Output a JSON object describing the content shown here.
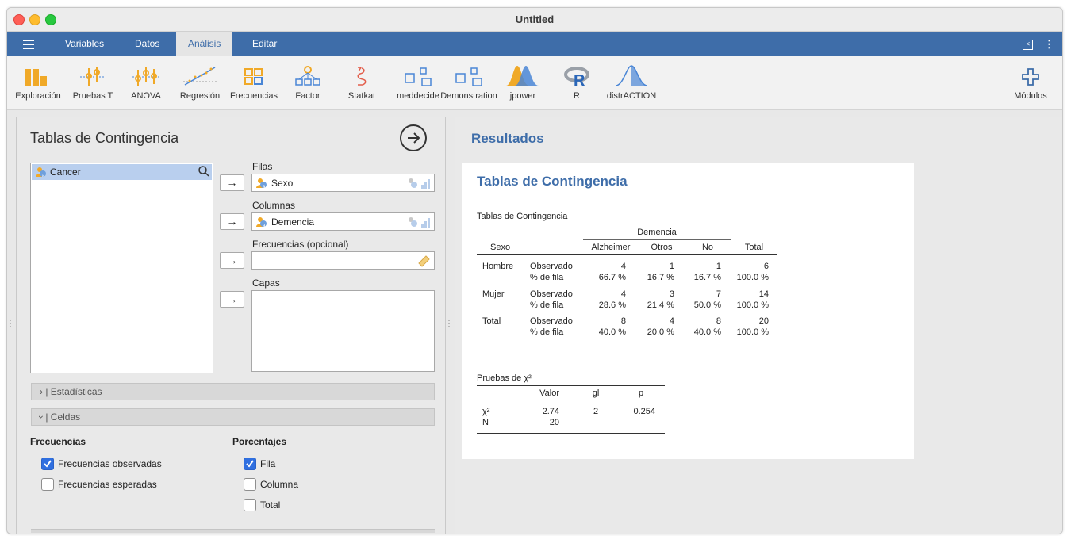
{
  "window": {
    "title": "Untitled"
  },
  "menu": {
    "tabs": [
      {
        "label": "Variables"
      },
      {
        "label": "Datos"
      },
      {
        "label": "Análisis"
      },
      {
        "label": "Editar"
      }
    ]
  },
  "toolbar": {
    "items": [
      {
        "label": "Exploración",
        "icon": "exploration-icon"
      },
      {
        "label": "Pruebas T",
        "icon": "t-tests-icon"
      },
      {
        "label": "ANOVA",
        "icon": "anova-icon"
      },
      {
        "label": "Regresión",
        "icon": "regression-icon"
      },
      {
        "label": "Frecuencias",
        "icon": "frequencies-icon"
      },
      {
        "label": "Factor",
        "icon": "factor-icon"
      },
      {
        "label": "Statkat",
        "icon": "statkat-icon"
      },
      {
        "label": "meddecide",
        "icon": "meddecide-icon"
      },
      {
        "label": "Demonstration",
        "icon": "demonstration-icon"
      },
      {
        "label": "jpower",
        "icon": "jpower-icon"
      },
      {
        "label": "R",
        "icon": "r-icon"
      },
      {
        "label": "distrACTION",
        "icon": "distraction-icon"
      }
    ],
    "modules_label": "Módulos",
    "accent": "#3e6da9"
  },
  "analysis": {
    "title": "Tablas de Contingencia",
    "source_vars": [
      "Cancer"
    ],
    "rows_label": "Filas",
    "rows_value": "Sexo",
    "cols_label": "Columnas",
    "cols_value": "Demencia",
    "freq_label": "Frecuencias (opcional)",
    "layers_label": "Capas",
    "section_stats": "Estadísticas",
    "section_cells": "Celdas",
    "counts_header": "Frecuencias",
    "observed_label": "Frecuencias observadas",
    "observed_checked": true,
    "expected_label": "Frecuencias esperadas",
    "expected_checked": false,
    "percent_header": "Porcentajes",
    "row_label": "Fila",
    "row_checked": true,
    "column_label": "Columna",
    "column_checked": false,
    "total_label": "Total",
    "total_checked": false
  },
  "results": {
    "header": "Resultados",
    "card_title": "Tablas de Contingencia",
    "table1": {
      "caption": "Tablas de Contingencia",
      "group_header": "Demencia",
      "row_var": "Sexo",
      "col_headers": [
        "Alzheimer",
        "Otros",
        "No",
        "Total"
      ],
      "rows": [
        {
          "group": "Hombre",
          "obs_label": "Observado",
          "pct_label": "% de fila",
          "obs": [
            "4",
            "1",
            "1",
            "6"
          ],
          "pct": [
            "66.7 %",
            "16.7 %",
            "16.7 %",
            "100.0 %"
          ]
        },
        {
          "group": "Mujer",
          "obs_label": "Observado",
          "pct_label": "% de fila",
          "obs": [
            "4",
            "3",
            "7",
            "14"
          ],
          "pct": [
            "28.6 %",
            "21.4 %",
            "50.0 %",
            "100.0 %"
          ]
        },
        {
          "group": "Total",
          "obs_label": "Observado",
          "pct_label": "% de fila",
          "obs": [
            "8",
            "4",
            "8",
            "20"
          ],
          "pct": [
            "40.0 %",
            "20.0 %",
            "40.0 %",
            "100.0 %"
          ]
        }
      ]
    },
    "table2": {
      "caption": "Pruebas de χ²",
      "headers": [
        "Valor",
        "gl",
        "p"
      ],
      "rows": [
        {
          "name": "χ²",
          "valor": "2.74",
          "gl": "2",
          "p": "0.254"
        },
        {
          "name": "N",
          "valor": "20",
          "gl": "",
          "p": ""
        }
      ]
    }
  }
}
